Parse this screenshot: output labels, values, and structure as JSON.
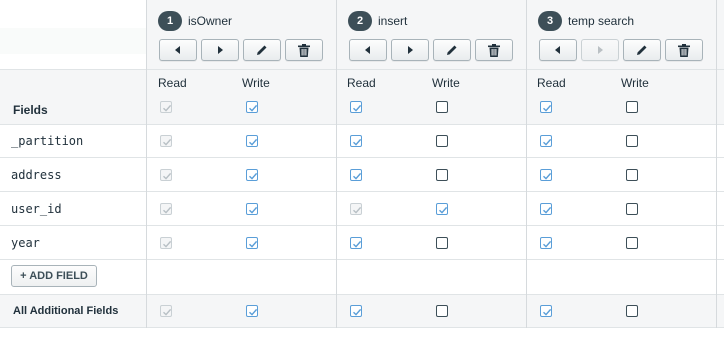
{
  "fields_header": "Fields",
  "col_read": "Read",
  "col_write": "Write",
  "add_field_label": "+ ADD FIELD",
  "additional_fields_label": "All Additional Fields",
  "roles": [
    {
      "number": "1",
      "name": "isOwner"
    },
    {
      "number": "2",
      "name": "insert"
    },
    {
      "number": "3",
      "name": "temp search"
    }
  ],
  "fields": [
    {
      "name": "_partition"
    },
    {
      "name": "address"
    },
    {
      "name": "user_id"
    },
    {
      "name": "year"
    }
  ],
  "permissions": {
    "header_row": [
      {
        "read": "disabled-checked",
        "write": "checked"
      },
      {
        "read": "checked",
        "write": "empty"
      },
      {
        "read": "checked",
        "write": "empty"
      }
    ],
    "field_rows": [
      [
        {
          "read": "disabled-checked",
          "write": "checked"
        },
        {
          "read": "checked",
          "write": "empty"
        },
        {
          "read": "checked",
          "write": "empty"
        }
      ],
      [
        {
          "read": "disabled-checked",
          "write": "checked"
        },
        {
          "read": "checked",
          "write": "empty"
        },
        {
          "read": "checked",
          "write": "empty"
        }
      ],
      [
        {
          "read": "disabled-checked",
          "write": "checked"
        },
        {
          "read": "disabled-checked",
          "write": "checked"
        },
        {
          "read": "checked",
          "write": "empty"
        }
      ],
      [
        {
          "read": "disabled-checked",
          "write": "checked"
        },
        {
          "read": "checked",
          "write": "empty"
        },
        {
          "read": "checked",
          "write": "empty"
        }
      ]
    ],
    "additional_row": [
      {
        "read": "disabled-checked",
        "write": "checked"
      },
      {
        "read": "checked",
        "write": "empty"
      },
      {
        "read": "checked",
        "write": "empty"
      }
    ]
  },
  "toolbar_icons": [
    "move-left-icon",
    "move-right-icon",
    "edit-icon",
    "delete-icon"
  ],
  "colors": {
    "check_blue": "#5a9ed8",
    "check_disabled": "#b8c0c5",
    "badge_bg": "#3d4f58"
  }
}
